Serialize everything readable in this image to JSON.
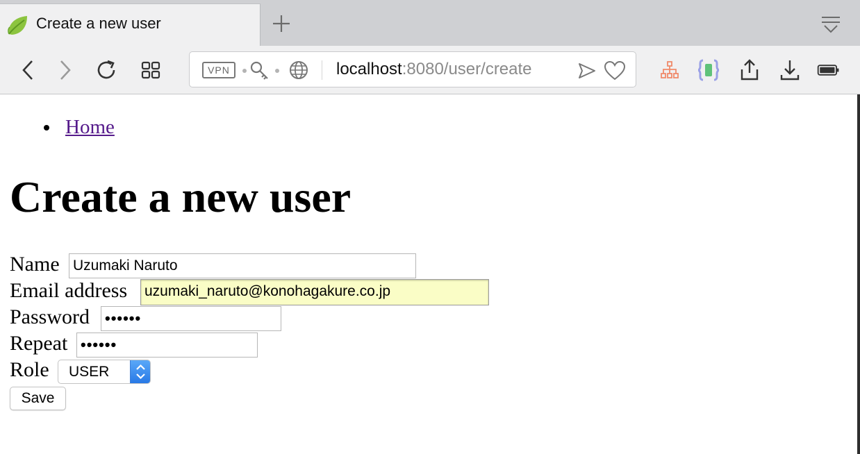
{
  "browser": {
    "tab": {
      "title": "Create a new user",
      "icon": "spring-leaf-icon"
    },
    "toolbar": {
      "back_icon": "chevron-left-icon",
      "forward_icon": "chevron-right-icon",
      "reload_icon": "reload-icon",
      "tabs_grid_icon": "grid-icon",
      "vpn_label": "VPN",
      "url": {
        "host": "localhost",
        "rest": ":8080/user/create"
      },
      "extensions": [
        "sitemap-icon",
        "braces-extension-icon"
      ],
      "share_icon": "share-icon",
      "download_icon": "download-icon",
      "battery_icon": "battery-icon"
    },
    "colors": {
      "tabbar": "#cfd0d3",
      "toolbar": "#f0f0f1",
      "visited_link": "#551a8b",
      "autofill": "#fafdc6",
      "select_accent": "#2f80ed"
    }
  },
  "page": {
    "nav": {
      "home_link": "Home"
    },
    "title": "Create a new user",
    "form": {
      "name": {
        "label": "Name",
        "value": "Uzumaki Naruto"
      },
      "email": {
        "label": "Email address",
        "value": "uzumaki_naruto@konohagakure.co.jp"
      },
      "password": {
        "label": "Password",
        "value": "••••••"
      },
      "repeat": {
        "label": "Repeat",
        "value": "••••••"
      },
      "role": {
        "label": "Role",
        "value": "USER"
      },
      "save_label": "Save"
    }
  }
}
